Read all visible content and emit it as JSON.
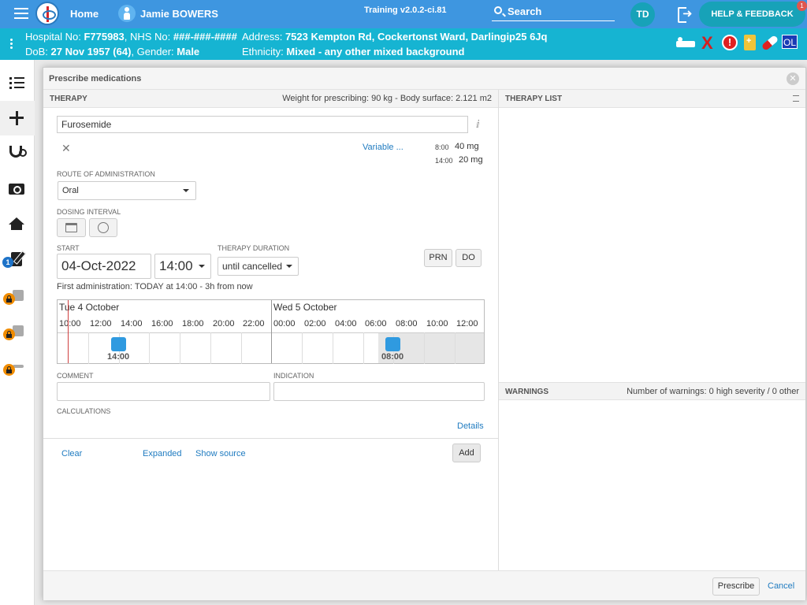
{
  "topbar": {
    "home": "Home",
    "patient_name": "Jamie BOWERS",
    "training": "Training v2.0.2-ci.81",
    "search": "Search",
    "avatar": "TD",
    "help": "HELP & FEEDBACK",
    "help_badge": "1"
  },
  "banner": {
    "hospital_label": "Hospital No:",
    "hospital_no": "F775983",
    "nhs_label": ", NHS No:",
    "nhs_no": "###-###-####",
    "dob_label": "DoB:",
    "dob": "27 Nov 1957 (64)",
    "gender_label": ", Gender:",
    "gender": "Male",
    "address_label": "Address:",
    "address": "7523 Kempton Rd, Cockertonst Ward, Darlingip25 6Jq",
    "ethnicity_label": "Ethnicity:",
    "ethnicity": "Mixed - any other mixed background",
    "icons": [
      "bed-icon",
      "cross-icon",
      "alert-icon",
      "medication-icon",
      "pill-icon",
      "ol-icon"
    ],
    "alert_glyph": "!",
    "x_glyph": "X",
    "ol": "OL"
  },
  "sidebar": {
    "prescription_badge": "1"
  },
  "modal": {
    "title": "Prescribe medications",
    "therapy_label": "THERAPY",
    "weight_info": "Weight for prescribing: 90 kg - Body surface: 2.121 m2",
    "medication": "Furosemide",
    "variable_link": "Variable ...",
    "doses": [
      {
        "time": "8:00",
        "amount": "40 mg"
      },
      {
        "time": "14:00",
        "amount": "20 mg"
      }
    ],
    "route_label": "ROUTE OF ADMINISTRATION",
    "route_value": "Oral",
    "dosing_label": "DOSING INTERVAL",
    "start_label": "START",
    "start_date": "04-Oct-2022",
    "start_time": "14:00",
    "duration_label": "THERAPY DURATION",
    "duration_value": "until cancelled",
    "prn": "PRN",
    "do": "DO",
    "first_admin": "First administration: TODAY at 14:00 - 3h from now",
    "timeline": {
      "day1": "Tue 4 October",
      "day2": "Wed 5 October",
      "hours1": [
        "10:00",
        "12:00",
        "14:00",
        "16:00",
        "18:00",
        "20:00",
        "22:00"
      ],
      "hours2": [
        "00:00",
        "02:00",
        "04:00",
        "06:00",
        "08:00",
        "10:00",
        "12:00"
      ],
      "dose1": "14:00",
      "dose2": "08:00"
    },
    "comment_label": "COMMENT",
    "indication_label": "INDICATION",
    "calculations_label": "CALCULATIONS",
    "details": "Details",
    "clear": "Clear",
    "expanded": "Expanded",
    "show_source": "Show source",
    "add": "Add",
    "therapy_list_label": "THERAPY LIST",
    "warnings_label": "WARNINGS",
    "warnings_count": "Number of warnings: 0 high severity / 0 other",
    "prescribe": "Prescribe",
    "cancel": "Cancel"
  },
  "colors": {
    "topbar": "#3e96e0",
    "banner": "#16b4d2",
    "teal_button": "#17a2b8",
    "dose_marker": "#2f9ae0",
    "link": "#1f7bc0"
  }
}
